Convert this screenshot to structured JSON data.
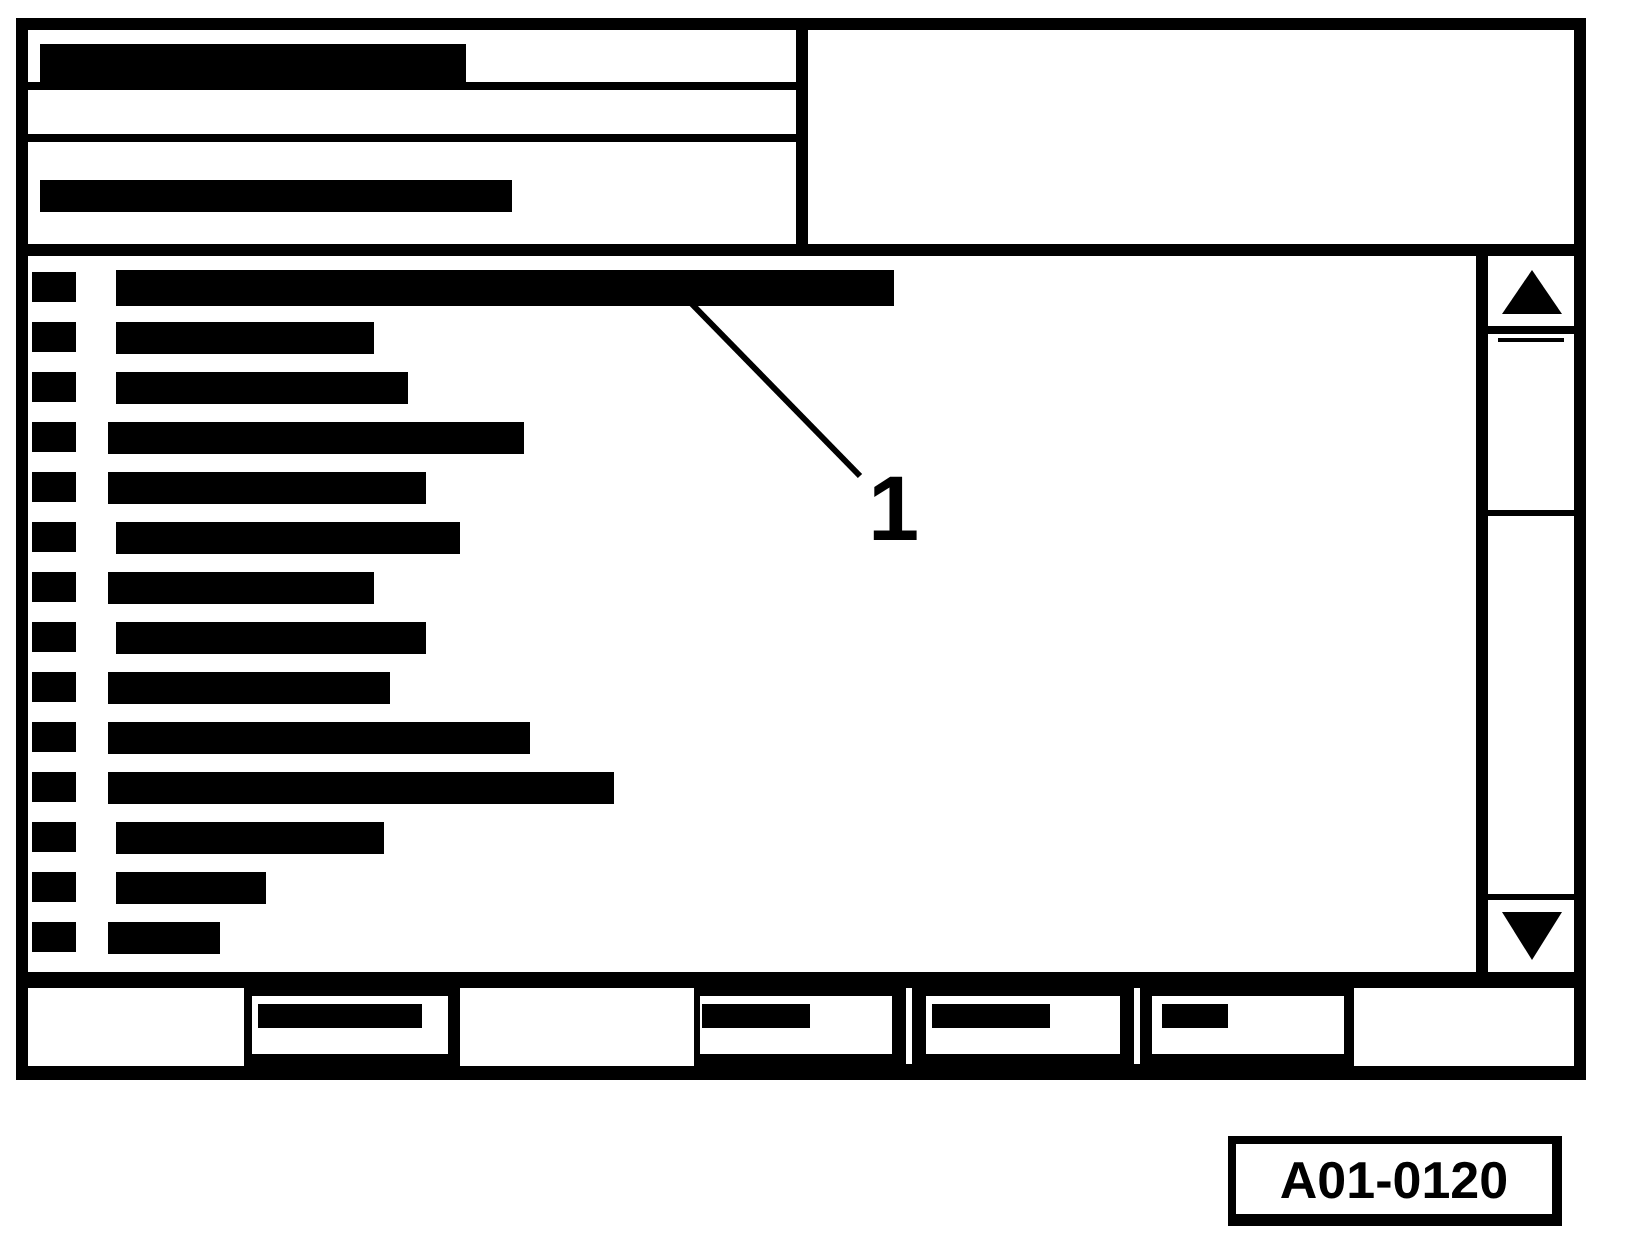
{
  "screen": {
    "header_fields": [
      {
        "kind": "redacted_text"
      },
      {
        "kind": "blank"
      },
      {
        "kind": "redacted_text"
      }
    ],
    "list_items": [
      {
        "kind": "redacted_text"
      },
      {
        "kind": "redacted_text"
      },
      {
        "kind": "redacted_text"
      },
      {
        "kind": "redacted_text"
      },
      {
        "kind": "redacted_text"
      },
      {
        "kind": "redacted_text"
      },
      {
        "kind": "redacted_text"
      },
      {
        "kind": "redacted_text"
      },
      {
        "kind": "redacted_text"
      },
      {
        "kind": "redacted_text"
      },
      {
        "kind": "redacted_text"
      },
      {
        "kind": "redacted_text"
      },
      {
        "kind": "redacted_text"
      },
      {
        "kind": "redacted_text"
      }
    ],
    "softkeys": [
      {
        "kind": "blank"
      },
      {
        "kind": "redacted_text"
      },
      {
        "kind": "blank"
      },
      {
        "kind": "redacted_text"
      },
      {
        "kind": "redacted_text"
      },
      {
        "kind": "redacted_text"
      },
      {
        "kind": "blank"
      }
    ]
  },
  "callouts": [
    {
      "label": "1"
    }
  ],
  "figure_id": "A01-0120"
}
